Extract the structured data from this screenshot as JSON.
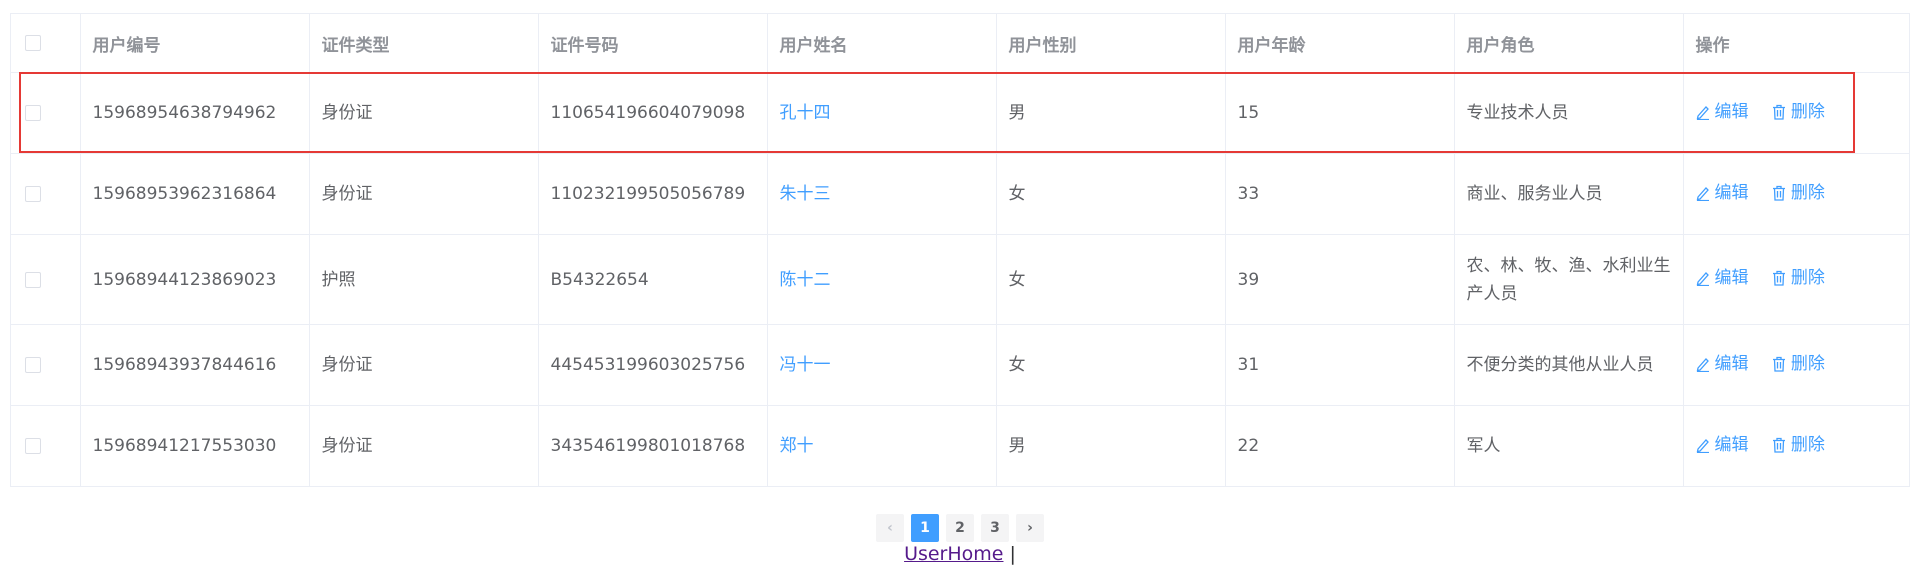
{
  "table": {
    "headers": [
      "用户编号",
      "证件类型",
      "证件号码",
      "用户姓名",
      "用户性别",
      "用户年龄",
      "用户角色",
      "操作"
    ],
    "rows": [
      {
        "id": "15968954638794962",
        "cert_type": "身份证",
        "cert_no": "110654196604079098",
        "name": "孔十四",
        "gender": "男",
        "age": "15",
        "role": "专业技术人员",
        "edit": "编辑",
        "delete": "删除"
      },
      {
        "id": "15968953962316864",
        "cert_type": "身份证",
        "cert_no": "110232199505056789",
        "name": "朱十三",
        "gender": "女",
        "age": "33",
        "role": "商业、服务业人员",
        "edit": "编辑",
        "delete": "删除"
      },
      {
        "id": "15968944123869023",
        "cert_type": "护照",
        "cert_no": "B54322654",
        "name": "陈十二",
        "gender": "女",
        "age": "39",
        "role": "农、林、牧、渔、水利业生产人员",
        "edit": "编辑",
        "delete": "删除"
      },
      {
        "id": "15968943937844616",
        "cert_type": "身份证",
        "cert_no": "445453199603025756",
        "name": "冯十一",
        "gender": "女",
        "age": "31",
        "role": "不便分类的其他从业人员",
        "edit": "编辑",
        "delete": "删除"
      },
      {
        "id": "15968941217553030",
        "cert_type": "身份证",
        "cert_no": "343546199801018768",
        "name": "郑十",
        "gender": "男",
        "age": "22",
        "role": "军人",
        "edit": "编辑",
        "delete": "删除"
      }
    ]
  },
  "pagination": {
    "prev": "‹",
    "pages": [
      "1",
      "2",
      "3"
    ],
    "current": "1",
    "next": "›"
  },
  "footer": {
    "link": "UserHome",
    "separator": "|"
  },
  "colors": {
    "accent": "#409eff",
    "highlight": "#e53935"
  }
}
